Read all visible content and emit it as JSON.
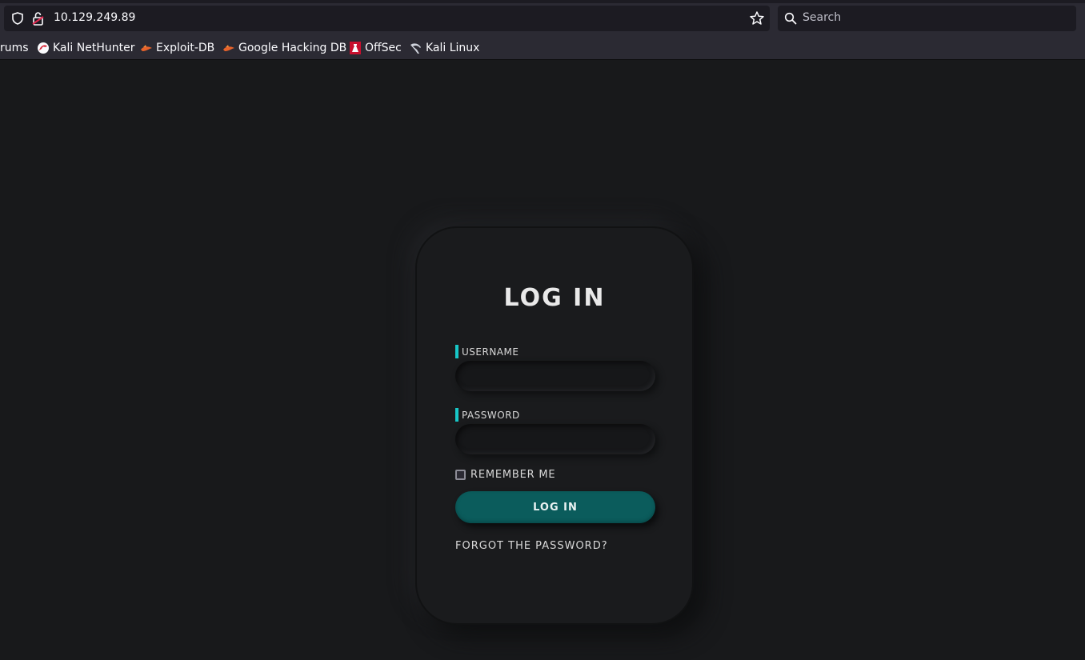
{
  "browser": {
    "url": "10.129.249.89",
    "search_placeholder": "Search"
  },
  "bookmarks": [
    {
      "label": "rums",
      "icon": "forums-icon"
    },
    {
      "label": "Kali NetHunter",
      "icon": "kali-nethunter-icon"
    },
    {
      "label": "Exploit-DB",
      "icon": "exploit-db-icon"
    },
    {
      "label": "Google Hacking DB",
      "icon": "google-hacking-db-icon"
    },
    {
      "label": "OffSec",
      "icon": "offsec-icon"
    },
    {
      "label": "Kali Linux",
      "icon": "kali-linux-icon"
    }
  ],
  "login": {
    "title": "LOG IN",
    "username_label": "USERNAME",
    "username_value": "",
    "password_label": "PASSWORD",
    "password_value": "",
    "remember_label": "REMEMBER ME",
    "remember_checked": false,
    "submit_label": "LOG IN",
    "forgot_label": "FORGOT THE PASSWORD?"
  },
  "colors": {
    "accent": "#17c7c7",
    "button": "#0b5c5c",
    "background": "#18191b"
  }
}
